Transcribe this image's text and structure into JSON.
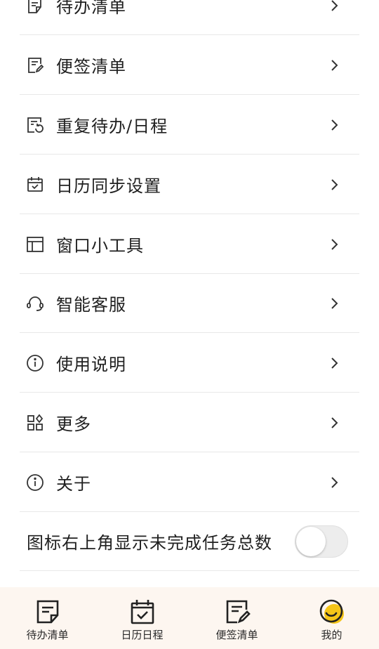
{
  "menu": {
    "items": [
      {
        "label": "待办清单",
        "icon": "todo-list-icon"
      },
      {
        "label": "便签清单",
        "icon": "note-list-icon"
      },
      {
        "label": "重复待办/日程",
        "icon": "repeat-todo-icon"
      },
      {
        "label": "日历同步设置",
        "icon": "calendar-sync-icon"
      },
      {
        "label": "窗口小工具",
        "icon": "widget-icon"
      },
      {
        "label": "智能客服",
        "icon": "headset-icon"
      },
      {
        "label": "使用说明",
        "icon": "info-icon"
      },
      {
        "label": "更多",
        "icon": "grid-icon"
      },
      {
        "label": "关于",
        "icon": "info-icon"
      }
    ],
    "toggle": {
      "label": "图标右上角显示未完成任务总数",
      "enabled": false
    }
  },
  "tabbar": {
    "tabs": [
      {
        "label": "待办清单",
        "icon": "todo-tab-icon"
      },
      {
        "label": "日历日程",
        "icon": "calendar-tab-icon"
      },
      {
        "label": "便签清单",
        "icon": "note-tab-icon"
      },
      {
        "label": "我的",
        "icon": "smiley-tab-icon",
        "active": true
      }
    ]
  },
  "colors": {
    "accent": "#f5c518",
    "tabbar_bg": "#fdf6f0",
    "divider": "#e8e8e8"
  }
}
